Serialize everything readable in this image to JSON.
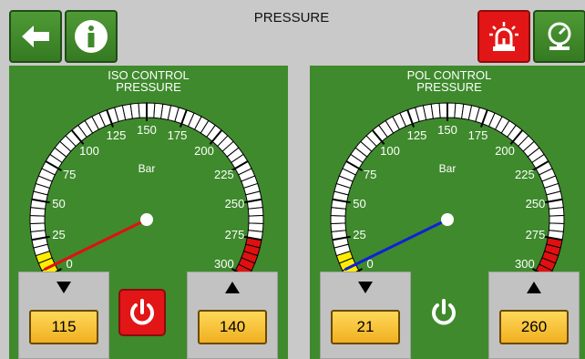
{
  "header": {
    "title": "PRESSURE"
  },
  "toolbar": {
    "back_icon": "arrow-left-icon",
    "info_icon": "info-icon",
    "alarm_icon": "siren-icon",
    "gauge_icon": "gauge-icon"
  },
  "gauge_scale": {
    "unit": "Bar",
    "min": 0,
    "max": 300,
    "labels": [
      "0",
      "25",
      "50",
      "75",
      "100",
      "125",
      "150",
      "175",
      "200",
      "225",
      "250",
      "275",
      "300"
    ]
  },
  "panels": [
    {
      "label_line1": "ISO CONTROL",
      "label_line2": "PRESSURE",
      "needle_color": "#e01010",
      "needle_value": 5,
      "low_setpoint": "115",
      "high_setpoint": "140",
      "power_state": "alarm",
      "power_color": "#e21616"
    },
    {
      "label_line1": "POL CONTROL",
      "label_line2": "PRESSURE",
      "needle_color": "#1020d8",
      "needle_value": 5,
      "low_setpoint": "21",
      "high_setpoint": "260",
      "power_state": "on",
      "power_color": "#3f8a2d"
    }
  ],
  "colors": {
    "panel_green": "#3f8a2d",
    "zone_yellow": "#ffee00",
    "zone_red": "#e01010"
  }
}
